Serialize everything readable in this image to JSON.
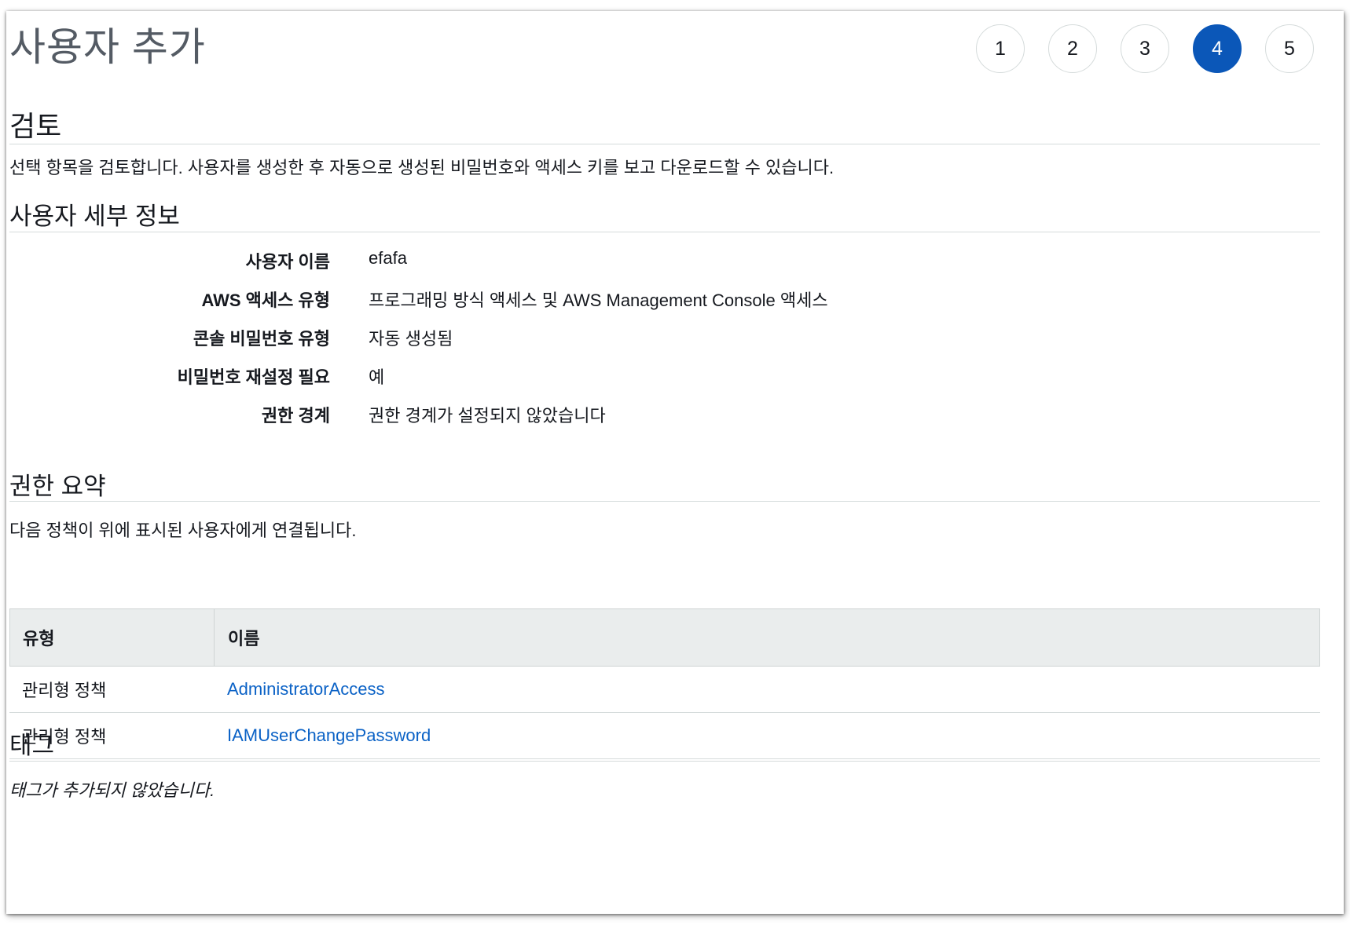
{
  "header": {
    "title": "사용자 추가",
    "steps": [
      "1",
      "2",
      "3",
      "4",
      "5"
    ],
    "active_step": 4
  },
  "review": {
    "title": "검토",
    "description": "선택 항목을 검토합니다. 사용자를 생성한 후 자동으로 생성된 비밀번호와 액세스 키를 보고 다운로드할 수 있습니다."
  },
  "user_details": {
    "title": "사용자 세부 정보",
    "rows": [
      {
        "label": "사용자 이름",
        "value": "efafa"
      },
      {
        "label": "AWS 액세스 유형",
        "value": "프로그래밍 방식 액세스 및 AWS Management Console 액세스"
      },
      {
        "label": "콘솔 비밀번호 유형",
        "value": "자동 생성됨"
      },
      {
        "label": "비밀번호 재설정 필요",
        "value": "예"
      },
      {
        "label": "권한 경계",
        "value": "권한 경계가 설정되지 않았습니다"
      }
    ]
  },
  "permissions": {
    "title": "권한 요약",
    "description": "다음 정책이 위에 표시된 사용자에게 연결됩니다.",
    "columns": [
      "유형",
      "이름"
    ],
    "rows": [
      {
        "type": "관리형 정책",
        "name": "AdministratorAccess"
      },
      {
        "type": "관리형 정책",
        "name": "IAMUserChangePassword"
      }
    ]
  },
  "tags": {
    "title": "태그",
    "empty_text": "태그가 추가되지 않았습니다."
  },
  "colors": {
    "accent": "#0b57b8",
    "link": "#0b62c6",
    "table_header_bg": "#eaeded",
    "rule": "#d5dbdb"
  }
}
